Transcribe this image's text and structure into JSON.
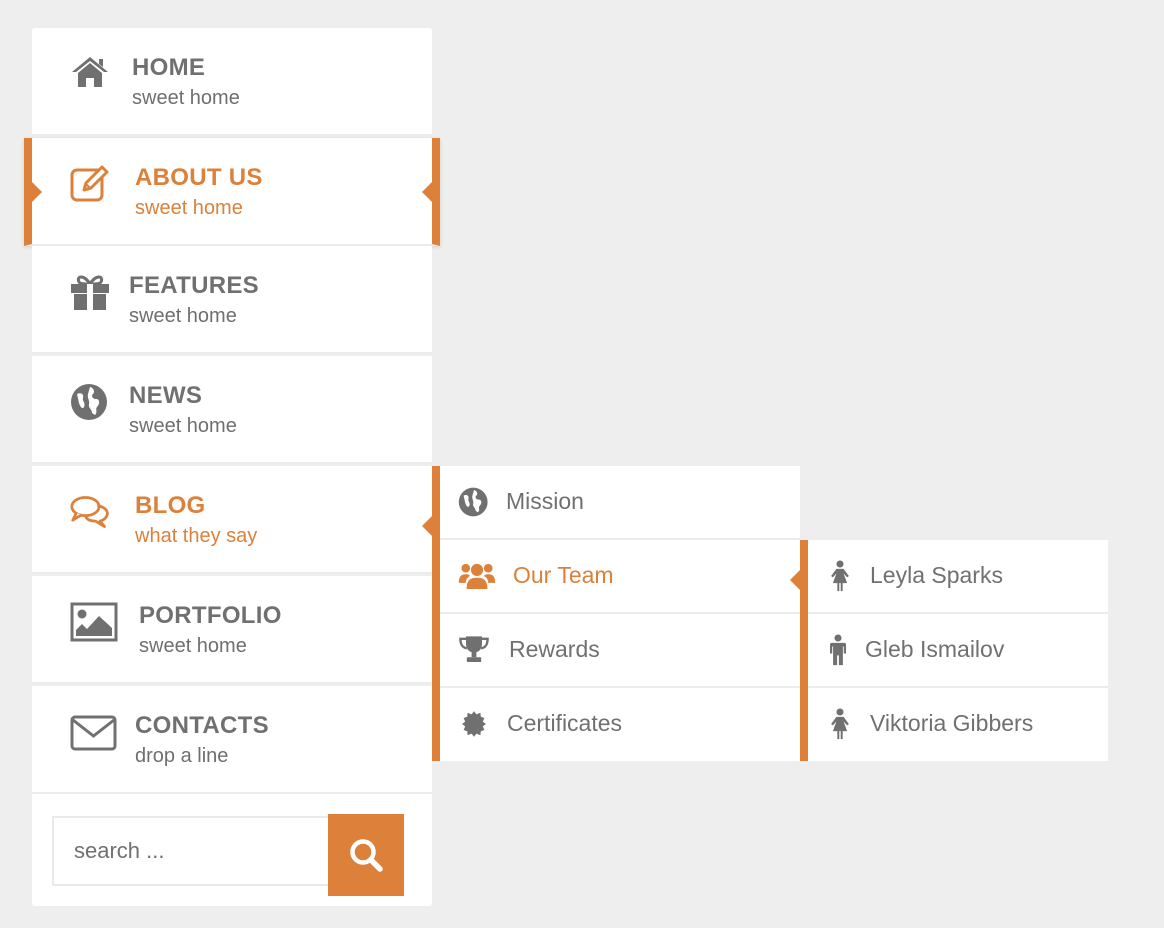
{
  "accent_color": "#dc803a",
  "text_color": "#707070",
  "menu": {
    "items": [
      {
        "label": "HOME",
        "sub": "sweet home",
        "icon": "home-icon"
      },
      {
        "label": "ABOUT US",
        "sub": "sweet home",
        "icon": "edit-icon",
        "active": true
      },
      {
        "label": "FEATURES",
        "sub": "sweet home",
        "icon": "gift-icon"
      },
      {
        "label": "NEWS",
        "sub": "sweet home",
        "icon": "globe-icon"
      },
      {
        "label": "BLOG",
        "sub": "what they say",
        "icon": "comments-icon",
        "open": true
      },
      {
        "label": "PORTFOLIO",
        "sub": "sweet home",
        "icon": "image-icon"
      },
      {
        "label": "CONTACTS",
        "sub": "drop a line",
        "icon": "envelope-icon"
      }
    ]
  },
  "search": {
    "placeholder": "search ...",
    "button_icon": "search-icon"
  },
  "submenu": {
    "items": [
      {
        "label": "Mission",
        "icon": "globe-icon"
      },
      {
        "label": "Our Team",
        "icon": "group-icon",
        "open": true
      },
      {
        "label": "Rewards",
        "icon": "trophy-icon"
      },
      {
        "label": "Certificates",
        "icon": "certificate-icon"
      }
    ]
  },
  "team": {
    "items": [
      {
        "label": "Leyla Sparks",
        "icon": "female-icon"
      },
      {
        "label": "Gleb Ismailov",
        "icon": "male-icon"
      },
      {
        "label": "Viktoria Gibbers",
        "icon": "female-icon"
      }
    ]
  }
}
